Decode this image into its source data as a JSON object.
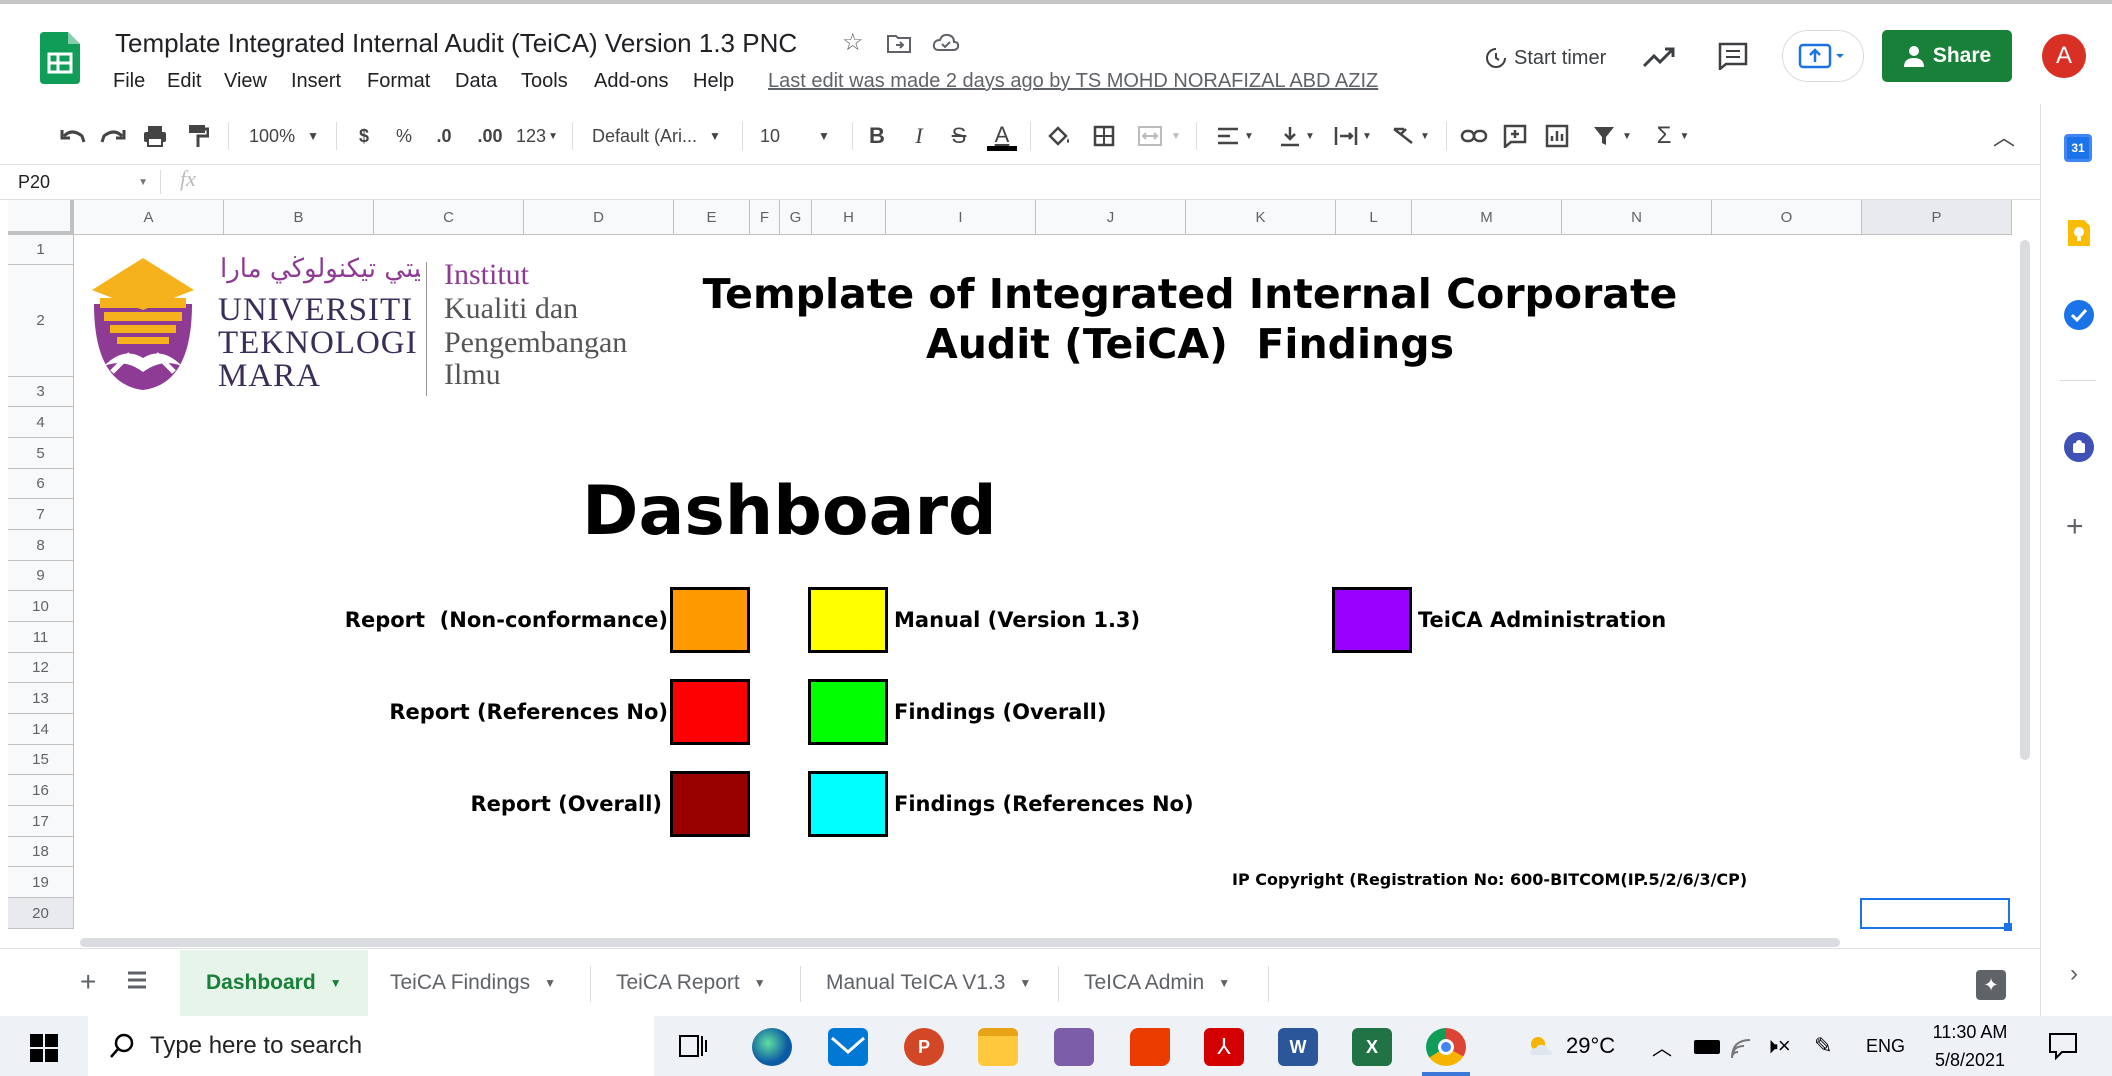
{
  "app": {
    "doc_title": "Template Integrated Internal Audit (TeiCA) Version 1.3 PNC",
    "menu": [
      "File",
      "Edit",
      "View",
      "Insert",
      "Format",
      "Data",
      "Tools",
      "Add-ons",
      "Help"
    ],
    "last_edit": "Last edit was made 2 days ago by TS MOHD NORAFIZAL ABD AZIZ",
    "start_timer": "Start timer",
    "share_label": "Share",
    "avatar_letter": "A"
  },
  "toolbar": {
    "zoom": "100%",
    "currency": "$",
    "percent": "%",
    "dec_less": ".0",
    "dec_more": ".00",
    "format_more": "123",
    "font": "Default (Ari...",
    "font_size": "10",
    "bold": "B",
    "italic": "I",
    "strike": "S",
    "text_color": "A",
    "sum": "Σ"
  },
  "formula_bar": {
    "cell_ref": "P20",
    "fx": "fx"
  },
  "grid": {
    "columns": [
      "A",
      "B",
      "C",
      "D",
      "E",
      "F",
      "G",
      "H",
      "I",
      "J",
      "K",
      "L",
      "M",
      "N",
      "O",
      "P"
    ],
    "rows": [
      "1",
      "2",
      "3",
      "4",
      "5",
      "6",
      "7",
      "8",
      "9",
      "10",
      "11",
      "12",
      "13",
      "14",
      "15",
      "16",
      "17",
      "18",
      "19",
      "20"
    ]
  },
  "sheet": {
    "logo": {
      "arabic": "اونيۏرسيتي تيكنولوڬي مارا",
      "uni_line1": "UNIVERSITI",
      "uni_line2": "TEKNOLOGI",
      "uni_line3": "MARA",
      "inst_line1": "Institut",
      "inst_line2": "Kualiti dan",
      "inst_line3": "Pengembangan",
      "inst_line4": "Ilmu"
    },
    "title_line1": "Template of Integrated Internal Corporate",
    "title_line2": "Audit (TeiCA)  Findings",
    "dashboard": "Dashboard",
    "buttons": [
      {
        "label": "Report  (Non-conformance)",
        "color": "#ff9900"
      },
      {
        "label": "Report (References No)",
        "color": "#ff0000"
      },
      {
        "label": "Report (Overall)",
        "color": "#990000"
      },
      {
        "label": "Manual (Version 1.3)",
        "color": "#ffff00"
      },
      {
        "label": "Findings (Overall)",
        "color": "#00ff00"
      },
      {
        "label": "Findings (References No)",
        "color": "#00ffff"
      },
      {
        "label": "TeiCA Administration",
        "color": "#9900ff"
      }
    ],
    "copyright": "IP Copyright (Registration No: 600-BITCOM(IP.5/2/6/3/CP)"
  },
  "tabs": [
    "Dashboard",
    "TeiCA Findings",
    "TeiCA Report",
    "Manual TeICA V1.3",
    "TeICA Admin"
  ],
  "taskbar": {
    "search_placeholder": "Type here to search",
    "weather": "29°C",
    "lang": "ENG",
    "time": "11:30 AM",
    "date": "5/8/2021"
  },
  "colors": {
    "sheets_green": "#0f9d58",
    "share_green": "#188038",
    "avatar_red": "#d93025",
    "active_tab_green": "#188038",
    "selection_blue": "#1a73e8"
  }
}
